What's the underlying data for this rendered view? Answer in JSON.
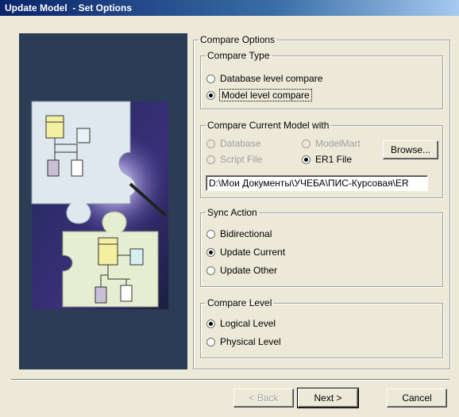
{
  "window": {
    "title": "Update Model  - Set Options"
  },
  "compare_options": {
    "legend": "Compare Options",
    "compare_type": {
      "legend": "Compare Type",
      "options": [
        "Database level compare",
        "Model level compare"
      ],
      "selected": "Model level compare"
    },
    "compare_with": {
      "legend": "Compare Current Model with",
      "options": [
        "Database",
        "ModelMart",
        "Script File",
        "ER1 File"
      ],
      "selected": "ER1 File",
      "browse_label": "Browse...",
      "file_path": "D:\\Мои Документы\\УЧЕБА\\ПИС-Курсовая\\ER"
    },
    "sync_action": {
      "legend": "Sync Action",
      "options": [
        "Bidirectional",
        "Update Current",
        "Update Other"
      ],
      "selected": "Update Current"
    },
    "compare_level": {
      "legend": "Compare Level",
      "options": [
        "Logical Level",
        "Physical Level"
      ],
      "selected": "Logical Level"
    }
  },
  "buttons": {
    "back": "< Back",
    "next": "Next >",
    "cancel": "Cancel"
  }
}
